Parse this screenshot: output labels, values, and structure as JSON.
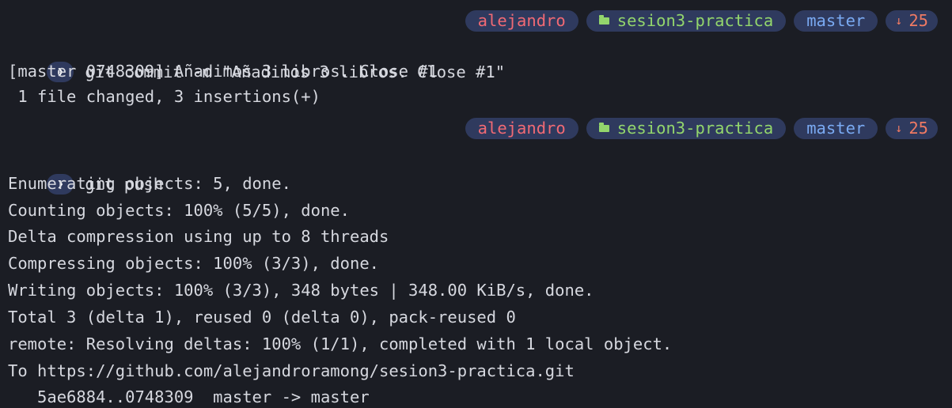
{
  "prompt_status": {
    "user": "alejandro",
    "directory": "sesion3-practica",
    "branch": "master",
    "behind_icon": "arrow-down-icon",
    "behind_count": "25"
  },
  "prompt_glyph": "❯",
  "colors": {
    "background": "#1b1d24",
    "pill_background": "#2f3a5e",
    "user": "#f16a74",
    "directory": "#93d66c",
    "branch": "#7aaaf2",
    "behind": "#f07a63",
    "text": "#d6d8df"
  },
  "commands": {
    "commit": "git commit -m \"Añadimos 3 libros. Close #1\"",
    "push": "git push"
  },
  "commit_output": [
    "[master 0748309] Añadimos 3 libros. Close #1",
    " 1 file changed, 3 insertions(+)"
  ],
  "push_output": [
    "Enumerating objects: 5, done.",
    "Counting objects: 100% (5/5), done.",
    "Delta compression using up to 8 threads",
    "Compressing objects: 100% (3/3), done.",
    "Writing objects: 100% (3/3), 348 bytes | 348.00 KiB/s, done.",
    "Total 3 (delta 1), reused 0 (delta 0), pack-reused 0",
    "remote: Resolving deltas: 100% (1/1), completed with 1 local object.",
    "To https://github.com/alejandroramong/sesion3-practica.git",
    "   5ae6884..0748309  master -> master"
  ]
}
